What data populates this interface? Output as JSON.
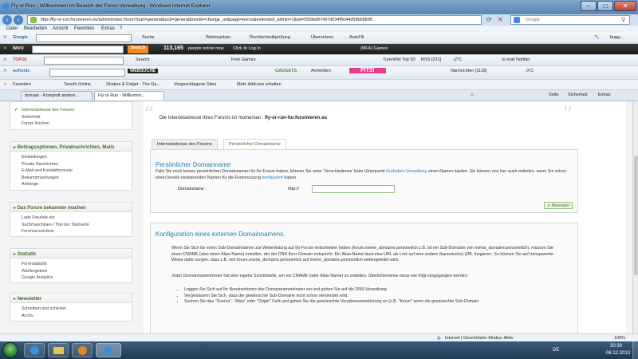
{
  "window": {
    "title": "Fly or Run - Willkommen im Bereich der Foren-Verwaltung - Windows Internet Explorer"
  },
  "address_bar": {
    "url": "http://fly-or-run.forumieren.eu/admin/index.forum?part=general&sub=general&mode=change_url&page=perso&extended_admin=1&tid=f359bd87497d034f5044d58bb58d5",
    "search_placeholder": "Google"
  },
  "menu": [
    "Datei",
    "Bearbeiten",
    "Ansicht",
    "Favoriten",
    "Extras",
    "?"
  ],
  "toolbars": {
    "google": {
      "brand": "Google",
      "search_label": "Suche",
      "items": [
        "Weitergeben",
        "Rechtschreibprüfung",
        "Übersetzen",
        "AutoFill"
      ],
      "user": "bugg..."
    },
    "imvu": {
      "brand": "IMVU",
      "search_label": "Search",
      "online_count": "113,165",
      "online_text": "people online now.",
      "login": "Click to Log In",
      "games": "(MFA) Games"
    },
    "top10": {
      "brand": "TOP10",
      "search_label": "Search",
      "free_games": "Free Games",
      "tunewiki": "TuneWiki Top 50",
      "rss": "RSS [231]",
      "temp": "-2°C",
      "email": "E-mail Notifier"
    },
    "softonic": {
      "brand": "softonic",
      "websuche": "WEBSUCHE",
      "gadgets": "GADGETS",
      "anmelden": "Anmelden",
      "pitsi": "PITSI",
      "nachrichten": "Nachrichten [1118]",
      "temp": "0°C"
    }
  },
  "favorites_bar": {
    "label": "Favoriten",
    "items": [
      "Tanoth Online",
      "Shakes & Fidget - The Ga...",
      "Vorgeschlagene Sites",
      "Mehr Add-ons erhalten"
    ]
  },
  "tabs": [
    {
      "label": "domain - Komplett andere..."
    },
    {
      "label": "Fly or Run - Willkomm..."
    }
  ],
  "tab_commands": [
    "Seite",
    "Sicherheit",
    "Extras"
  ],
  "sidebar": {
    "top_items": [
      "Internetadresse des Forums",
      "Sicherheit",
      "Forum löschen"
    ],
    "sections": [
      {
        "title": "Beitragsoptionen, Privatnachrichten, Mails",
        "items": [
          "Einstellungen",
          "Private Nachrichten",
          "E-Mail und Kontaktformular",
          "Bekanntmachungen",
          "Anhänge"
        ]
      },
      {
        "title": "Das Forum bekannter machen",
        "items": [
          "Lade Freunde ein",
          "Suchmaschinen / Titel der Startseite",
          "Forenverzeichnis"
        ]
      },
      {
        "title": "Statistik",
        "items": [
          "Forenstatistik",
          "Wahlergebnis",
          "Google Analytics"
        ]
      },
      {
        "title": "Newsletter",
        "items": [
          "Schreiben und schicken",
          "Archiv"
        ]
      }
    ]
  },
  "main": {
    "current_address_label": "Die Internetadresse Ihres Forums ist momentan :",
    "current_address_value": "fly-or-run-for.forumieren.eu",
    "subtabs": [
      "Internetadresse des Forums",
      "Persönlicher Domainname"
    ],
    "domain_panel": {
      "title": "Persönlicher Domainname",
      "text_1": "Falls Sie noch keinen persönlichen Domainnamen für Ihr Forum haben, können Sie unter 'Verschiedenes' beim Unterpunkt",
      "link_1": "Guthaben-Verwaltung",
      "text_2": "einen Namen kaufen. Sie können uns hier auch mitteilen, wenn Sie schon einen bereits existierenden Namen für die Forennutzung",
      "link_2": "konfiguriert",
      "text_3": "haben.",
      "field_label": "Domainname :",
      "field_prefix": "http://",
      "field_value": "",
      "send_label": "Absenden"
    },
    "config_panel": {
      "title": "Konfiguration eines externen Domainnamens.",
      "paragraph": "Wenn Sie Sich für einen Sub-Domainnamen zur Weiterleitung auf Ihr Forum entschieden haben (forum.meine_domaine.persoenlich z.B. ist ein Sub-Domaine von meine_domaine.persoenlich), müssen Sie einen CNAME (also einen Alias-Name) erstellen, der der DNS Ihrer Domain entspricht. Ein Alias-Name lässt eine URL als Link auf eine andere (kanonische) URL fungieren. So können Sie auf transparente Weise dafür sorgen, dass z.B. von forum.meine_domaine.persoenlich auf meine_domaine.persoenlich weitergeleitet wird.",
      "paragraph_2": "Jeder Domainnamenhoster hat eine eigene Schnittstelle, um ein CNAME (oder Alias-Name) zu erstellen. Überlicherweise muss wie folgt vorgegangen werden:",
      "bullets": [
        "Loggen Sie Sich auf Ihr Benutzerkonto des Domainnamenhoster ein und gehen Sie auf die DNS-Verwaltung",
        "Vergewissern Sie Sich, dass die gewünschte Sub-Domaine nicht schon verwendet wird.",
        "Suchen Sie das \"Source\", \"Alias\" oder \"Origin\" Feld und geben Sie die gewünschte Voradresserweiterung an (z.B. \"forum\" wenn die gewünschte Sub-Domain"
      ]
    }
  },
  "statusbar": {
    "zone": "Internet | Geschützter Modus: Aktiv",
    "zoom": "100%"
  },
  "taskbar": {
    "lang": "DE",
    "time": "20:30",
    "date": "06.12.2010"
  },
  "colors": {
    "accent_green": "#3d6b2a",
    "link_blue": "#2a7fb0"
  }
}
